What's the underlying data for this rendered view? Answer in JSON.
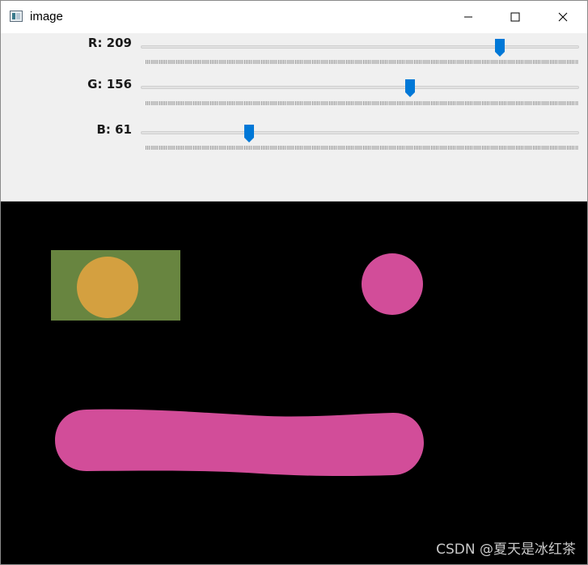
{
  "window": {
    "title": "image",
    "icon": "opencv-window-icon",
    "buttons": [
      "minimize-icon",
      "maximize-icon",
      "close-icon"
    ]
  },
  "trackbars": [
    {
      "label": "R: 209",
      "channel": "R",
      "value": 209,
      "max": 255
    },
    {
      "label": "G: 156",
      "channel": "G",
      "value": 156,
      "max": 255
    },
    {
      "label": "B: 61",
      "channel": "B",
      "value": 61,
      "max": 255
    }
  ],
  "colors": {
    "accent": "#0078d7",
    "canvas_bg": "#000000",
    "rectangle": "#688540",
    "orange_circle": "#d4a040",
    "pink_brush": "#d24d99"
  },
  "watermark": "CSDN @夏天是冰红茶"
}
